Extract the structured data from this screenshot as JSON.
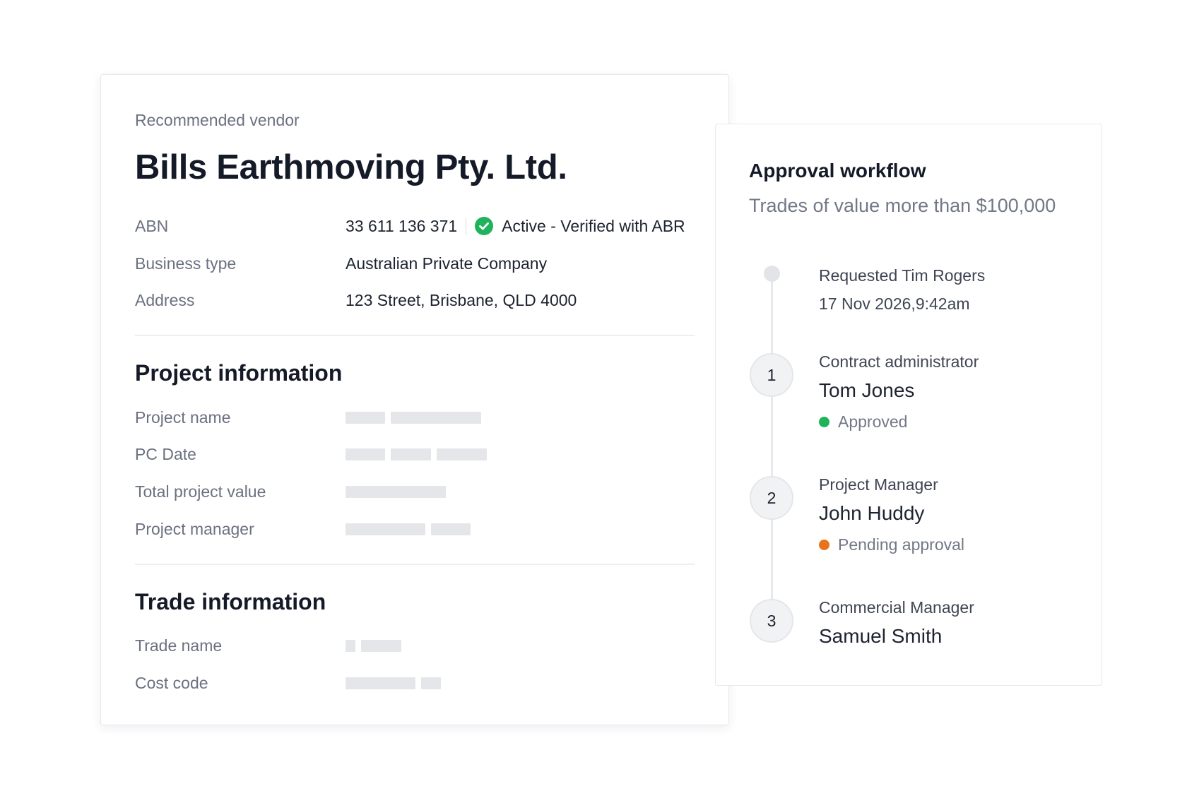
{
  "vendor": {
    "eyebrow": "Recommended vendor",
    "name": "Bills Earthmoving Pty. Ltd.",
    "abn": {
      "label": "ABN",
      "value": "33 611 136 371",
      "status": "Active - Verified with ABR",
      "status_icon": "check-circle-icon",
      "status_color": "#1fb35b"
    },
    "business_type": {
      "label": "Business type",
      "value": "Australian Private Company"
    },
    "address": {
      "label": "Address",
      "value": "123 Street, Brisbane, QLD 4000"
    }
  },
  "project_info": {
    "title": "Project information",
    "fields": [
      {
        "label": "Project name"
      },
      {
        "label": "PC Date"
      },
      {
        "label": "Total project value"
      },
      {
        "label": "Project manager"
      }
    ]
  },
  "trade_info": {
    "title": "Trade information",
    "fields": [
      {
        "label": "Trade name"
      },
      {
        "label": "Cost code"
      }
    ]
  },
  "approval": {
    "title": "Approval workflow",
    "subtitle": "Trades of value more than $100,000",
    "request": {
      "label": "Requested Tim Rogers",
      "timestamp": "17 Nov 2026,9:42am"
    },
    "steps": [
      {
        "number": "1",
        "role": "Contract administrator",
        "name": "Tom Jones",
        "status": "Approved",
        "status_color": "#1fb35b"
      },
      {
        "number": "2",
        "role": "Project Manager",
        "name": "John Huddy",
        "status": "Pending approval",
        "status_color": "#e8731a"
      },
      {
        "number": "3",
        "role": "Commercial Manager",
        "name": "Samuel Smith"
      }
    ]
  }
}
